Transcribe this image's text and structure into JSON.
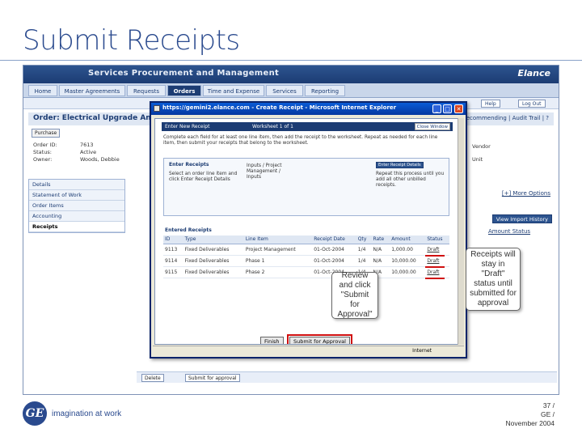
{
  "slide": {
    "title": "Submit Receipts"
  },
  "app": {
    "title": "Services Procurement and Management",
    "brand": "Elance",
    "nav": [
      "Home",
      "Master Agreements",
      "Requests",
      "Orders",
      "Time and Expense",
      "Services",
      "Reporting"
    ],
    "subnav": {
      "help": "Help",
      "logout": "Log Out"
    },
    "order_title": "Order: Electrical Upgrade Ana",
    "order_links": "Recommending | Audit Trail | ?",
    "purchase_button": "Purchase",
    "fields": [
      {
        "k": "Order ID:",
        "v": "7613"
      },
      {
        "k": "Status:",
        "v": "Active"
      },
      {
        "k": "Owner:",
        "v": "Woods, Debbie"
      }
    ],
    "right_values": [
      "Vendor",
      "Unit"
    ],
    "sidebar": [
      "Details",
      "Statement of Work",
      "Order Items",
      "Accounting",
      "Receipts"
    ],
    "more_options": "[+] More Options",
    "import_history": "View Import History",
    "amount_status": "Amount Status",
    "bottom_buttons": [
      "Delete",
      "Submit for approval"
    ]
  },
  "popup": {
    "title": "https://gemini2.elance.com - Create Receipt - Microsoft Internet Explorer",
    "header_left": "Enter New Receipt",
    "header_mid": "Worksheet 1 of 1",
    "close_window": "Close Window",
    "intro": "Complete each field for at least one line item, then add the receipt to the worksheet. Repeat as needed for each line item, then submit your receipts that belong to the worksheet.",
    "enter_receipts": {
      "title": "Enter Receipts",
      "text": "Select an order line item and click Enter Receipt Details",
      "items": "Inputs / Project Management / Inputs"
    },
    "select_box": "Enter Receipt Details",
    "right_text": "Repeat this process until you add all other unbilled receipts.",
    "entered_title": "Entered Receipts",
    "table": {
      "headers": [
        "ID",
        "Type",
        "Line Item",
        "Receipt Date",
        "Qty",
        "Rate",
        "Amount",
        "Status"
      ],
      "rows": [
        [
          "9113",
          "Fixed Deliverables",
          "Project Management",
          "01-Oct-2004",
          "1/4",
          "N/A",
          "1,000.00",
          "Draft"
        ],
        [
          "9114",
          "Fixed Deliverables",
          "Phase 1",
          "01-Oct-2004",
          "1/4",
          "N/A",
          "10,000.00",
          "Draft"
        ],
        [
          "9115",
          "Fixed Deliverables",
          "Phase 2",
          "01-Oct-2004",
          "1/4",
          "N/A",
          "10,000.00",
          "Draft"
        ]
      ]
    },
    "finish": "Finish",
    "submit": "Submit for Approval",
    "status_zone": "Internet"
  },
  "callouts": {
    "review": "Review and click \"Submit for Approval\"",
    "draft": "Receipts will stay in \"Draft\" status until submitted for approval"
  },
  "footer": {
    "logo": "GE",
    "tagline": "imagination at work",
    "page": "37 /",
    "org": "GE /",
    "date": "November 2004"
  }
}
